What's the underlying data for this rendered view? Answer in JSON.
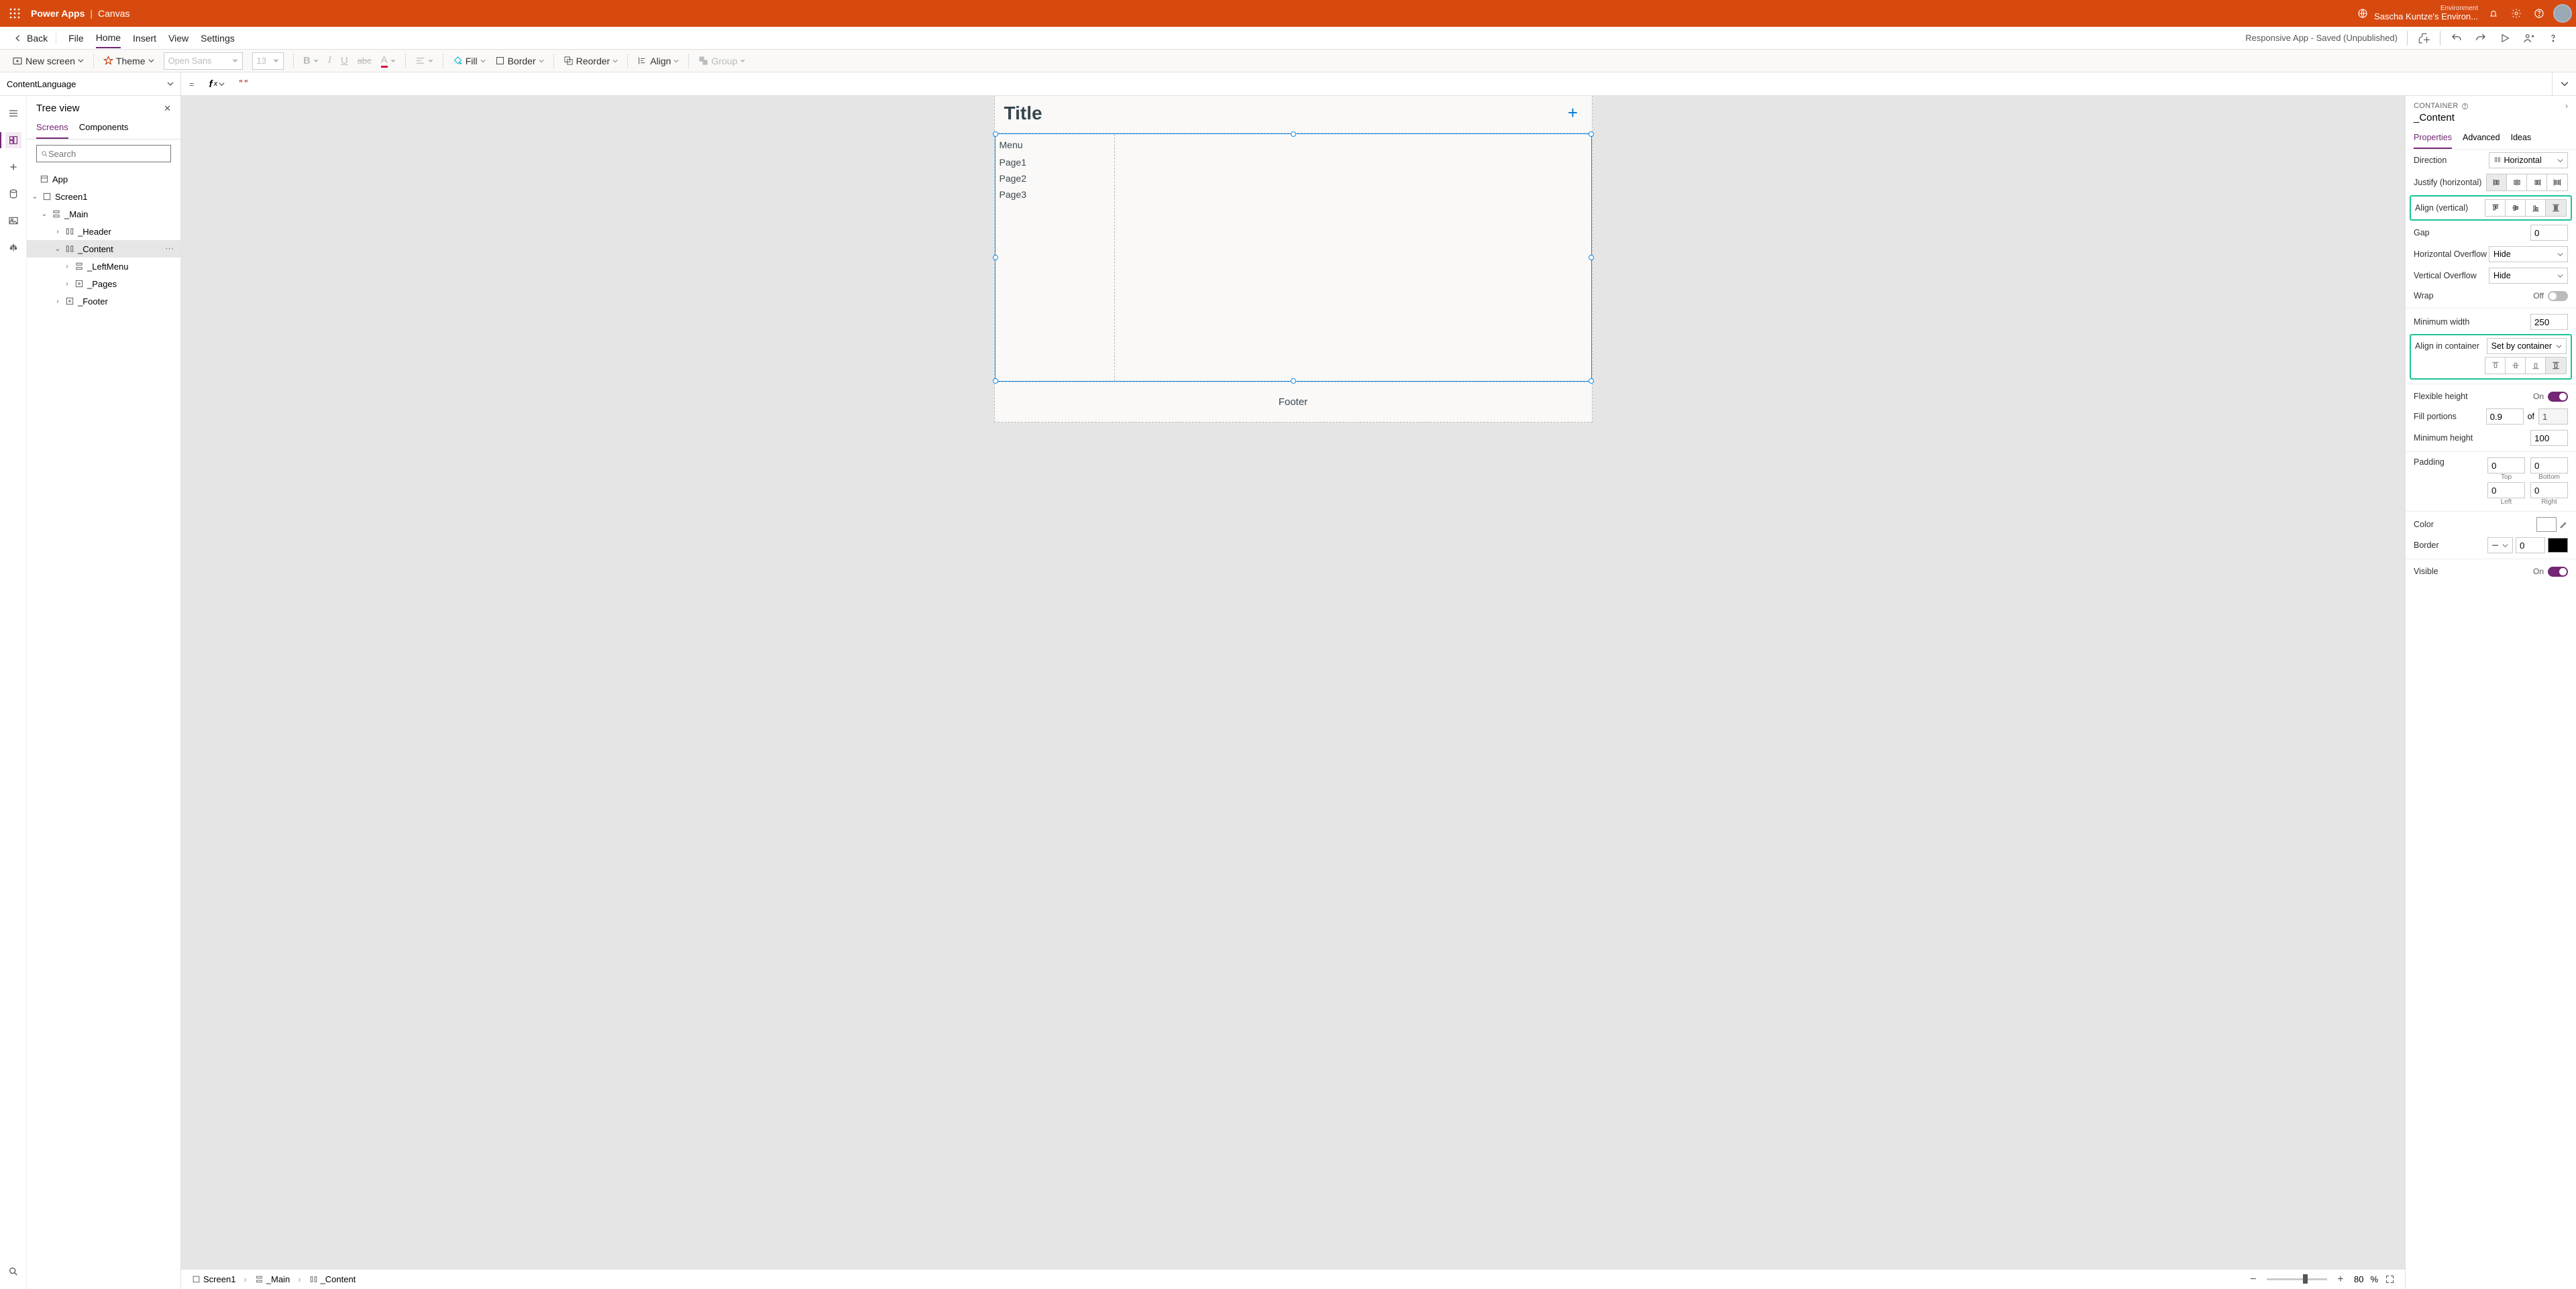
{
  "topbar": {
    "brand": "Power Apps",
    "separator": "|",
    "mode": "Canvas",
    "env_label": "Environment",
    "env_name": "Sascha Kuntze's Environ..."
  },
  "ribbon1": {
    "back": "Back",
    "tabs": [
      "File",
      "Home",
      "Insert",
      "View",
      "Settings"
    ],
    "active_tab": 1,
    "status": "Responsive App - Saved (Unpublished)"
  },
  "ribbon2": {
    "new_screen": "New screen",
    "theme": "Theme",
    "font": "Open Sans",
    "font_size": "13",
    "fill": "Fill",
    "border": "Border",
    "reorder": "Reorder",
    "align": "Align",
    "group": "Group"
  },
  "formula": {
    "property": "ContentLanguage",
    "value": "\"\""
  },
  "tree_panel": {
    "title": "Tree view",
    "tabs": [
      "Screens",
      "Components"
    ],
    "search_placeholder": "Search",
    "nodes": {
      "app": "App",
      "screen1": "Screen1",
      "main": "_Main",
      "header": "_Header",
      "content": "_Content",
      "leftmenu": "_LeftMenu",
      "pages": "_Pages",
      "footer": "_Footer"
    }
  },
  "canvas": {
    "title": "Title",
    "menu_head": "Menu",
    "menu_items": [
      "Page1",
      "Page2",
      "Page3"
    ],
    "footer": "Footer"
  },
  "status_bar": {
    "crumbs": [
      "Screen1",
      "_Main",
      "_Content"
    ],
    "zoom_value": "80",
    "zoom_unit": "%"
  },
  "properties_panel": {
    "type": "CONTAINER",
    "name": "_Content",
    "tabs": [
      "Properties",
      "Advanced",
      "Ideas"
    ],
    "rows": {
      "direction_label": "Direction",
      "direction_value": "Horizontal",
      "justify_label": "Justify (horizontal)",
      "align_v_label": "Align (vertical)",
      "gap_label": "Gap",
      "gap_value": "0",
      "h_overflow_label": "Horizontal Overflow",
      "h_overflow_value": "Hide",
      "v_overflow_label": "Vertical Overflow",
      "v_overflow_value": "Hide",
      "wrap_label": "Wrap",
      "wrap_value": "Off",
      "min_width_label": "Minimum width",
      "min_width_value": "250",
      "align_in_label": "Align in container",
      "align_in_value": "Set by container",
      "flex_h_label": "Flexible height",
      "flex_h_value": "On",
      "fill_portions_label": "Fill portions",
      "fill_portions_value": "0.9",
      "fill_portions_of": "of",
      "fill_portions_total": "1",
      "min_height_label": "Minimum height",
      "min_height_value": "100",
      "padding_label": "Padding",
      "pad_top": "0",
      "pad_top_l": "Top",
      "pad_bottom": "0",
      "pad_bottom_l": "Bottom",
      "pad_left": "0",
      "pad_left_l": "Left",
      "pad_right": "0",
      "pad_right_l": "Right",
      "color_label": "Color",
      "border_label": "Border",
      "border_width": "0",
      "visible_label": "Visible",
      "visible_value": "On"
    }
  }
}
